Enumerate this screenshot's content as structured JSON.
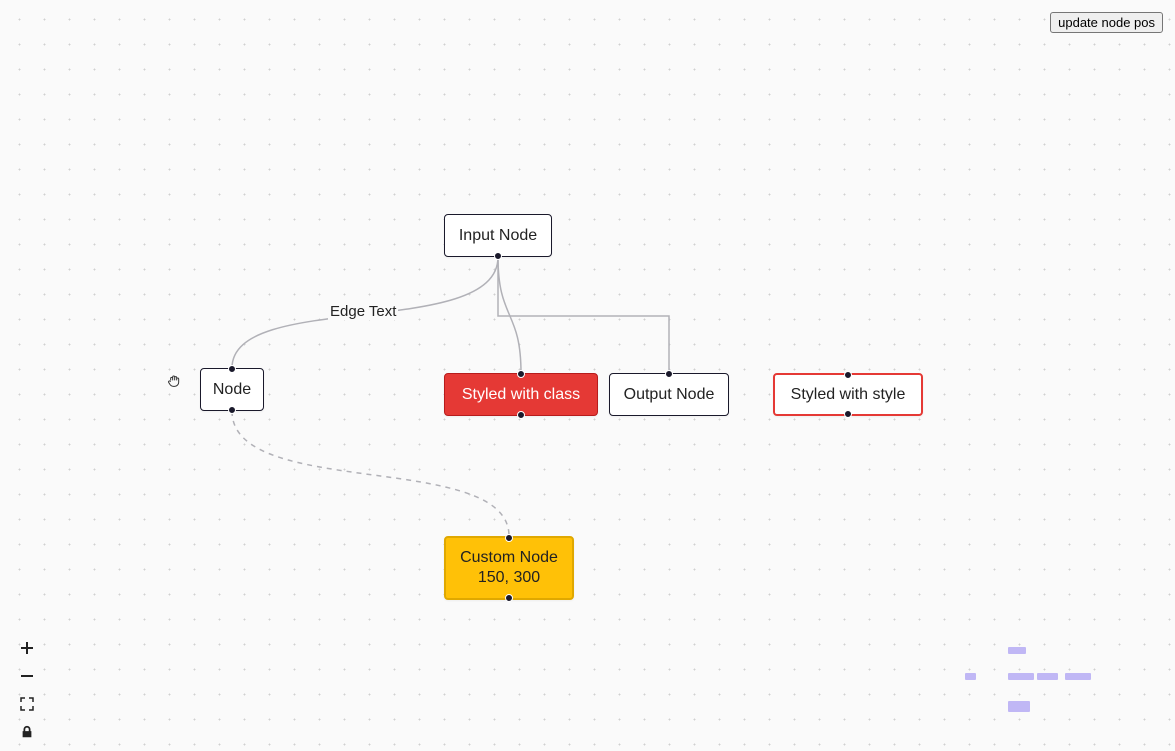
{
  "buttons": {
    "update_node_pos": "update node pos"
  },
  "nodes": {
    "input": {
      "label": "Input Node"
    },
    "node": {
      "label": "Node"
    },
    "styled_class": {
      "label": "Styled with class"
    },
    "output": {
      "label": "Output Node"
    },
    "styled_style": {
      "label": "Styled with style"
    },
    "custom": {
      "line1": "Custom Node",
      "line2": "150, 300"
    }
  },
  "edges": {
    "edge_text": {
      "label": "Edge Text"
    }
  },
  "colors": {
    "node_border": "#1a192b",
    "red_fill": "#e53935",
    "red_border": "#e53935",
    "yellow_fill": "#ffc107",
    "minimap_node": "#c0b7f5"
  },
  "controls": {
    "zoom_in": "plus-icon",
    "zoom_out": "minus-icon",
    "fit_view": "fit-view-icon",
    "lock": "lock-icon"
  }
}
